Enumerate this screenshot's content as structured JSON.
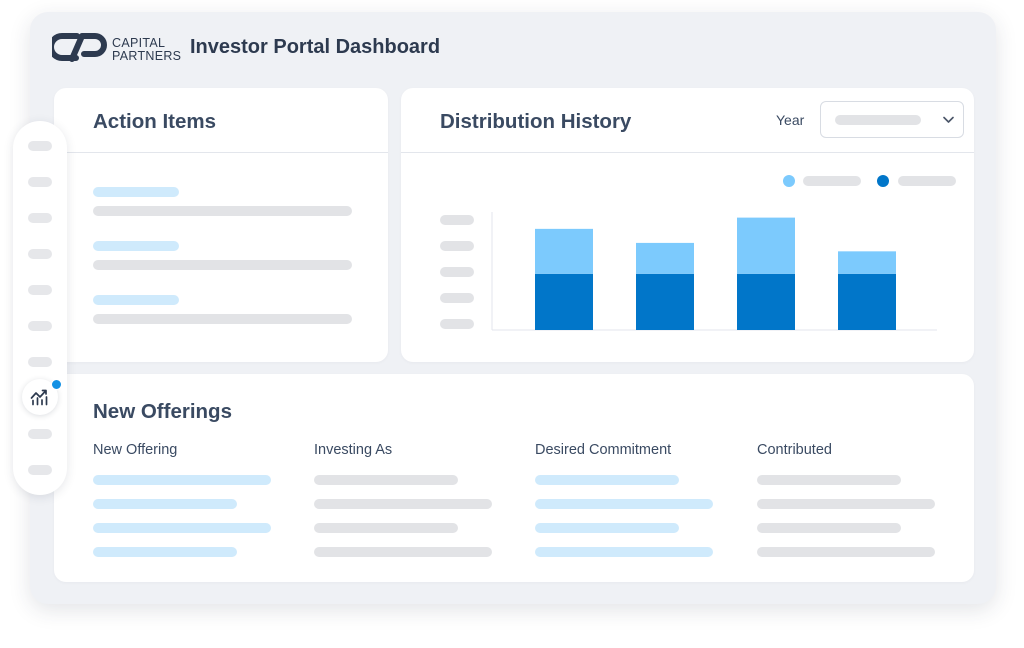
{
  "header": {
    "brand_line1": "CAPITAL",
    "brand_line2": "PARTNERS",
    "title": "Investor Portal Dashboard"
  },
  "action_items": {
    "title": "Action Items"
  },
  "distribution": {
    "title": "Distribution History",
    "year_label": "Year"
  },
  "chart_data": {
    "type": "bar",
    "stacked": true,
    "categories": [
      "",
      "",
      "",
      ""
    ],
    "series": [
      {
        "values": [
          2,
          2,
          2,
          2
        ],
        "color": "#0176c9"
      },
      {
        "values": [
          1.6,
          1.1,
          2.0,
          0.8
        ],
        "color": "#7ccafd"
      }
    ],
    "ylim": [
      0,
      4.2
    ],
    "grid": false
  },
  "offerings": {
    "title": "New Offerings",
    "columns": [
      "New Offering",
      "Investing As",
      "Desired Commitment",
      "Contributed"
    ]
  },
  "sidebar": {
    "active_icon": "analytics-icon"
  },
  "colors": {
    "primary": "#0176c9",
    "secondary": "#7ccafd",
    "text": "#3a4a62",
    "notification": "#1491e4"
  }
}
